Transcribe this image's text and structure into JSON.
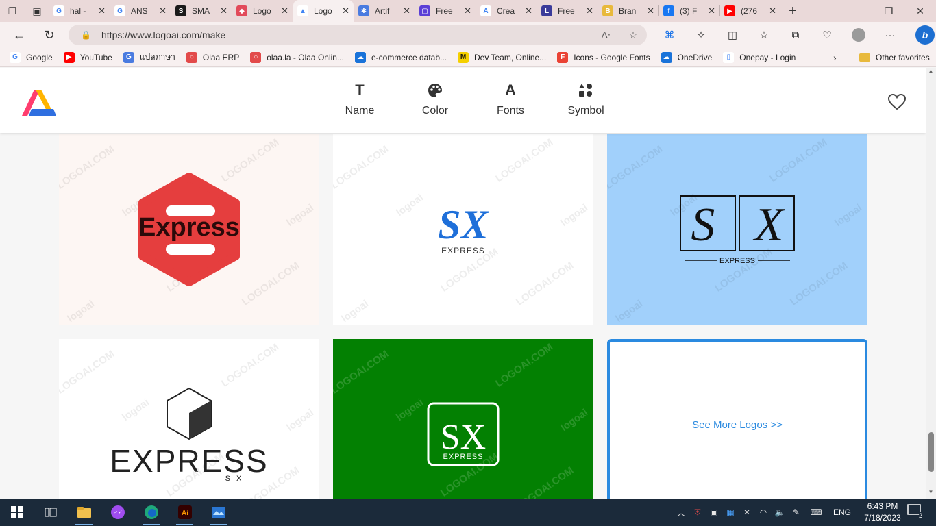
{
  "browser": {
    "tabs": [
      {
        "title": "hal -",
        "icon": "google-icon",
        "color": "#ffffff",
        "glyph": "G"
      },
      {
        "title": "ANS",
        "icon": "google-icon",
        "color": "#ffffff",
        "glyph": "G"
      },
      {
        "title": "SMA",
        "icon": "sma-icon",
        "color": "#1a1a1a",
        "glyph": "S"
      },
      {
        "title": "Logo",
        "icon": "logo-site-icon",
        "color": "#e24a5a",
        "glyph": "◆"
      },
      {
        "title": "Logo",
        "icon": "logoai-icon",
        "color": "#ffffff",
        "glyph": "▲",
        "active": true
      },
      {
        "title": "Artif",
        "icon": "artificial-icon",
        "color": "#4a7be0",
        "glyph": "✱"
      },
      {
        "title": "Free",
        "icon": "canva-icon",
        "color": "#5b3fd6",
        "glyph": "▢"
      },
      {
        "title": "Crea",
        "icon": "create-icon",
        "color": "#ffffff",
        "glyph": "A"
      },
      {
        "title": "Free",
        "icon": "l-icon",
        "color": "#3b3b9a",
        "glyph": "L"
      },
      {
        "title": "Bran",
        "icon": "brand-icon",
        "color": "#e8b93c",
        "glyph": "B"
      },
      {
        "title": "(3) F",
        "icon": "facebook-icon",
        "color": "#1877f2",
        "glyph": "f"
      },
      {
        "title": "(276",
        "icon": "youtube-icon",
        "color": "#ff0000",
        "glyph": "▶"
      }
    ],
    "url": "https://www.logoai.com/make",
    "favorites": [
      {
        "label": "Google",
        "icon": "google-icon",
        "color": "#ffffff",
        "glyph": "G"
      },
      {
        "label": "YouTube",
        "icon": "youtube-icon",
        "color": "#ff0000",
        "glyph": "▶"
      },
      {
        "label": "แปลภาษา",
        "icon": "translate-icon",
        "color": "#4a7be0",
        "glyph": "G"
      },
      {
        "label": "Olaa ERP",
        "icon": "olaa-icon",
        "color": "#e24a4a",
        "glyph": "○"
      },
      {
        "label": "olaa.la - Olaa Onlin...",
        "icon": "olaa-icon",
        "color": "#e24a4a",
        "glyph": "○"
      },
      {
        "label": "e-commerce datab...",
        "icon": "onedrive-icon",
        "color": "#1a73d9",
        "glyph": "☁"
      },
      {
        "label": "Dev Team, Online...",
        "icon": "miro-icon",
        "color": "#f5d000",
        "glyph": "M"
      },
      {
        "label": "Icons - Google Fonts",
        "icon": "google-fonts-icon",
        "color": "#ea4335",
        "glyph": "F"
      },
      {
        "label": "OneDrive",
        "icon": "onedrive-icon",
        "color": "#1a73d9",
        "glyph": "☁"
      },
      {
        "label": "Onepay - Login",
        "icon": "page-icon",
        "color": "#ffffff",
        "glyph": "▯"
      }
    ],
    "other_favorites": "Other favorites"
  },
  "site": {
    "nav": [
      {
        "label": "Name",
        "icon": "text-t-icon",
        "glyph": "T"
      },
      {
        "label": "Color",
        "icon": "palette-icon",
        "glyph": "🎨"
      },
      {
        "label": "Fonts",
        "icon": "font-a-icon",
        "glyph": "A"
      },
      {
        "label": "Symbol",
        "icon": "shapes-icon",
        "glyph": "▲●"
      }
    ],
    "watermark": "LOGOAI.COM",
    "watermark_logo": "logoai"
  },
  "logos": [
    {
      "id": "card-1",
      "bg": "#fdf6f3",
      "text": "Express",
      "sub": ""
    },
    {
      "id": "card-2",
      "bg": "#ffffff",
      "text": "SX",
      "sub": "EXPRESS"
    },
    {
      "id": "card-3",
      "bg": "#a1d0fb",
      "text": "S X",
      "sub": "EXPRESS"
    },
    {
      "id": "card-4",
      "bg": "#ffffff",
      "text": "EXPRESS",
      "sub": "S X"
    },
    {
      "id": "card-5",
      "bg": "#038002",
      "text": "SX",
      "sub": "EXPRESS"
    }
  ],
  "see_more": "See More Logos >>",
  "colors": {
    "accent": "#2a8ae0",
    "brand_red": "#e53e3e",
    "brand_blue": "#1e6fd9"
  },
  "taskbar": {
    "apps": [
      "windows-icon",
      "task-view-icon",
      "file-explorer-icon",
      "messenger-icon",
      "edge-icon",
      "illustrator-icon",
      "photo-icon"
    ],
    "language": "ENG",
    "time": "6:43 PM",
    "date": "7/18/2023",
    "notifications": "2"
  }
}
